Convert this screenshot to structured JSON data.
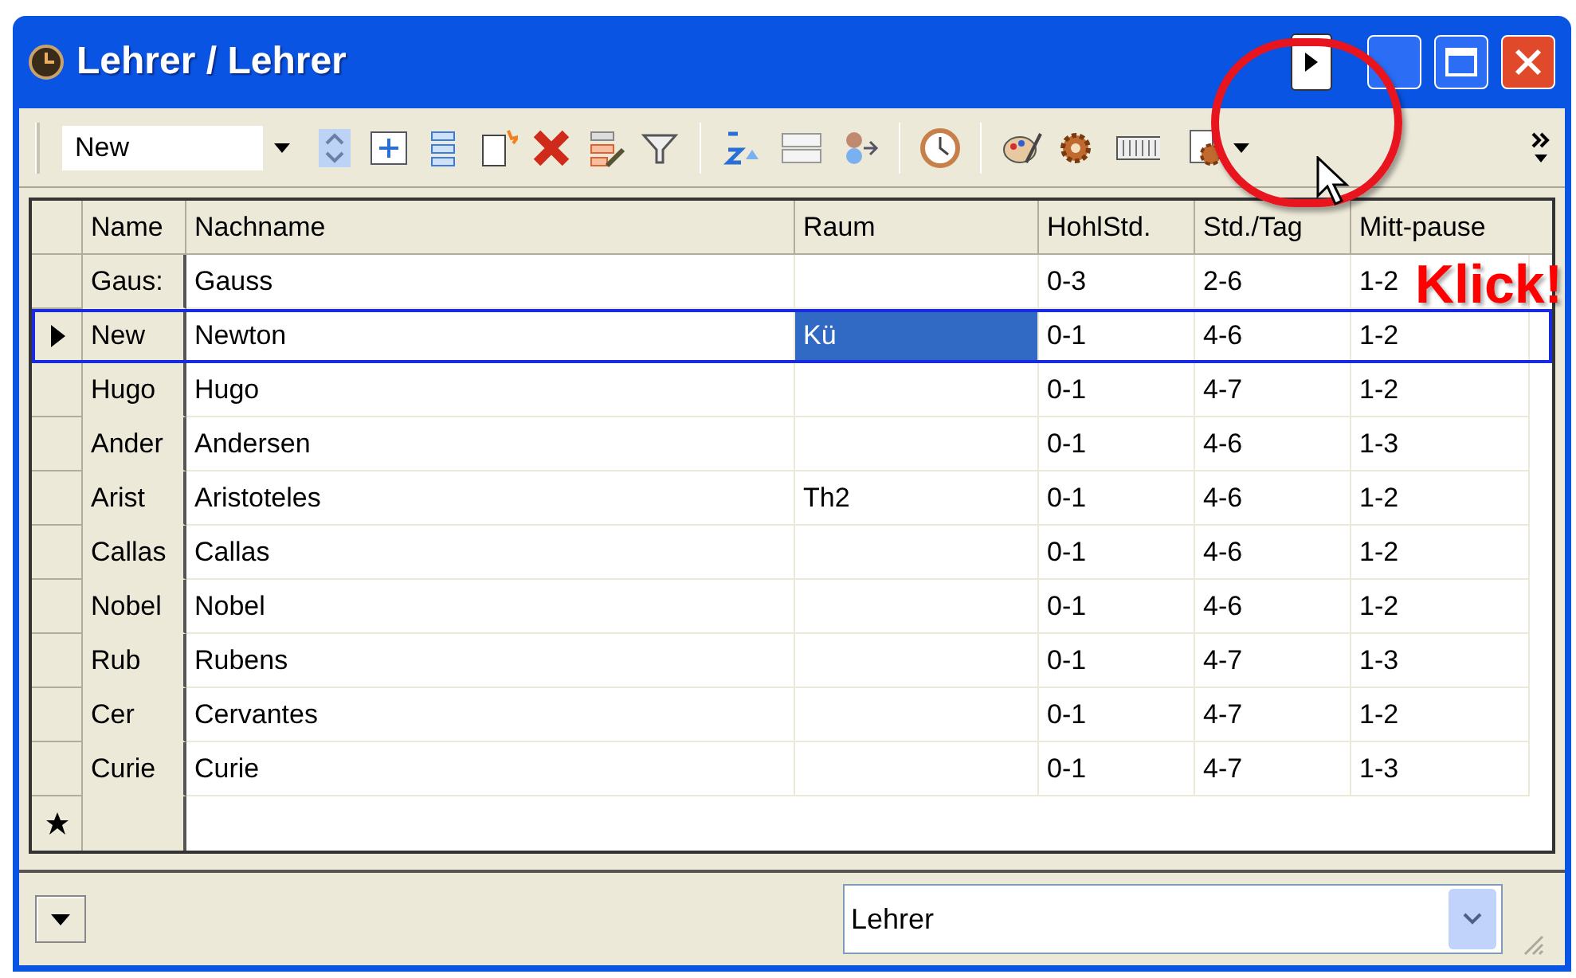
{
  "window": {
    "title": "Lehrer / Lehrer"
  },
  "toolbar": {
    "record_combo": {
      "value": "New"
    }
  },
  "table": {
    "columns": [
      "Name",
      "Nachname",
      "Raum",
      "HohlStd.",
      "Std./Tag",
      "Mitt-pause"
    ],
    "rows": [
      {
        "selected": false,
        "cells": [
          {
            "text": "Gaus:",
            "selected": false
          },
          {
            "text": "Gauss",
            "selected": false
          },
          {
            "selected": false
          },
          {
            "text": "0-3",
            "selected": false
          },
          {
            "text": "2-6",
            "selected": false
          },
          {
            "text": "1-2",
            "selected": false
          }
        ]
      },
      {
        "selected": true,
        "cells": [
          {
            "text": "New",
            "selected": false
          },
          {
            "text": "Newton",
            "selected": false
          },
          {
            "text": "Kü",
            "selected": true
          },
          {
            "text": "0-1",
            "selected": false
          },
          {
            "text": "4-6",
            "selected": false
          },
          {
            "text": "1-2",
            "selected": false
          }
        ]
      },
      {
        "selected": false,
        "cells": [
          {
            "text": "Hugo",
            "selected": false
          },
          {
            "text": "Hugo",
            "selected": false
          },
          {
            "selected": false
          },
          {
            "text": "0-1",
            "selected": false
          },
          {
            "text": "4-7",
            "selected": false
          },
          {
            "text": "1-2",
            "selected": false
          }
        ]
      },
      {
        "selected": false,
        "cells": [
          {
            "text": "Ander",
            "selected": false
          },
          {
            "text": "Andersen",
            "selected": false
          },
          {
            "selected": false
          },
          {
            "text": "0-1",
            "selected": false
          },
          {
            "text": "4-6",
            "selected": false
          },
          {
            "text": "1-3",
            "selected": false
          }
        ]
      },
      {
        "selected": false,
        "cells": [
          {
            "text": "Arist",
            "selected": false
          },
          {
            "text": "Aristoteles",
            "selected": false
          },
          {
            "text": "Th2",
            "selected": false
          },
          {
            "text": "0-1",
            "selected": false
          },
          {
            "text": "4-6",
            "selected": false
          },
          {
            "text": "1-2",
            "selected": false
          }
        ]
      },
      {
        "selected": false,
        "cells": [
          {
            "text": "Callas",
            "selected": false
          },
          {
            "text": "Callas",
            "selected": false
          },
          {
            "selected": false
          },
          {
            "text": "0-1",
            "selected": false
          },
          {
            "text": "4-6",
            "selected": false
          },
          {
            "text": "1-2",
            "selected": false
          }
        ]
      },
      {
        "selected": false,
        "cells": [
          {
            "text": "Nobel",
            "selected": false
          },
          {
            "text": "Nobel",
            "selected": false
          },
          {
            "selected": false
          },
          {
            "text": "0-1",
            "selected": false
          },
          {
            "text": "4-6",
            "selected": false
          },
          {
            "text": "1-2",
            "selected": false
          }
        ]
      },
      {
        "selected": false,
        "cells": [
          {
            "text": "Rub",
            "selected": false
          },
          {
            "text": "Rubens",
            "selected": false
          },
          {
            "selected": false
          },
          {
            "text": "0-1",
            "selected": false
          },
          {
            "text": "4-7",
            "selected": false
          },
          {
            "text": "1-3",
            "selected": false
          }
        ]
      },
      {
        "selected": false,
        "cells": [
          {
            "text": "Cer",
            "selected": false
          },
          {
            "text": "Cervantes",
            "selected": false
          },
          {
            "selected": false
          },
          {
            "text": "0-1",
            "selected": false
          },
          {
            "text": "4-7",
            "selected": false
          },
          {
            "text": "1-2",
            "selected": false
          }
        ]
      },
      {
        "selected": false,
        "cells": [
          {
            "text": "Curie",
            "selected": false
          },
          {
            "text": "Curie",
            "selected": false
          },
          {
            "selected": false
          },
          {
            "text": "0-1",
            "selected": false
          },
          {
            "text": "4-7",
            "selected": false
          },
          {
            "text": "1-3",
            "selected": false
          }
        ]
      }
    ]
  },
  "callout": {
    "text": "Klick!"
  },
  "bottom_bar": {
    "view_combo": {
      "value": "Lehrer"
    }
  }
}
